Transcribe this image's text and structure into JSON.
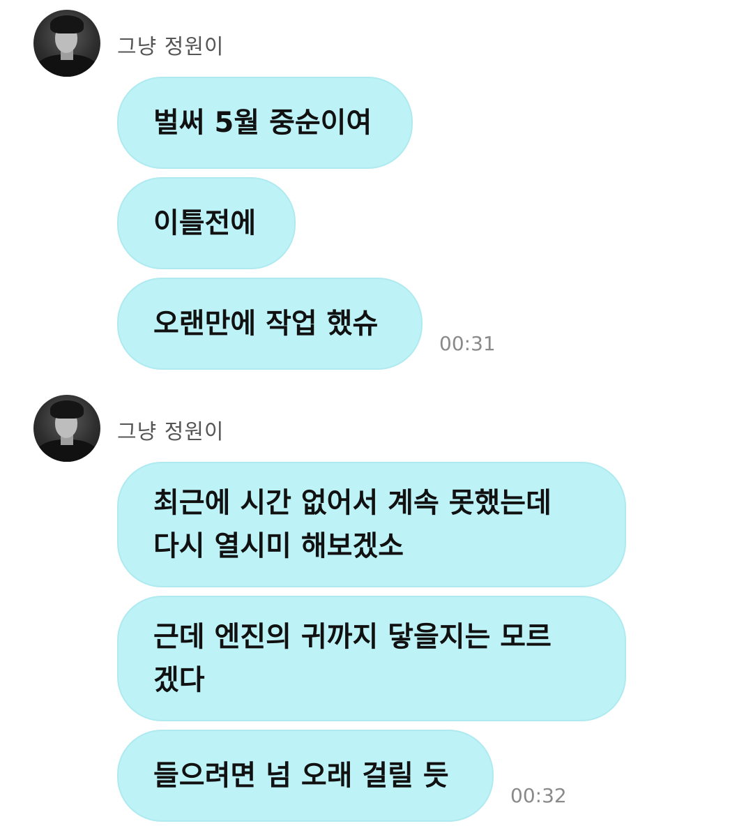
{
  "groups": [
    {
      "sender": "그냥 정원이",
      "avatar_icon": "profile-photo",
      "messages": [
        "벌써 5월 중순이여",
        "이틀전에",
        "오랜만에 작업 했슈"
      ],
      "time": "00:31"
    },
    {
      "sender": "그냥 정원이",
      "avatar_icon": "profile-photo",
      "messages": [
        "최근에 시간 없어서 계속 못했는데\n다시 열시미 해보겠소",
        "근데 엔진의 귀까지 닿을지는 모르\n겠다",
        "들으려면 넘 오래 걸릴 듯"
      ],
      "time": "00:32"
    }
  ],
  "colors": {
    "bubble": "#bdf2f6",
    "bubble_border": "#aeeaf0",
    "sender": "#555555",
    "time": "#8a8a8a"
  }
}
